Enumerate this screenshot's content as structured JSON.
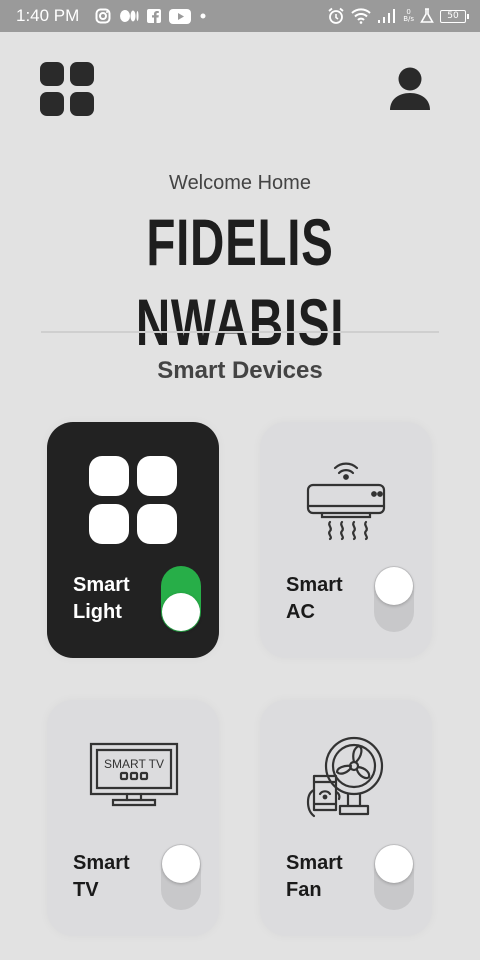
{
  "status_bar": {
    "time": "1:40 PM",
    "net_speed_value": "0",
    "net_speed_unit": "B/s",
    "battery": "50"
  },
  "header": {
    "welcome": "Welcome Home",
    "username": "FIDELIS NWABISI"
  },
  "section_title": "Smart Devices",
  "devices": [
    {
      "label": "Smart\nLight",
      "on": true,
      "icon": "light-grid-icon"
    },
    {
      "label": "Smart\nAC",
      "on": false,
      "icon": "air-conditioner-icon"
    },
    {
      "label": "Smart\nTV",
      "on": false,
      "icon": "smart-tv-icon",
      "icon_text": "SMART TV"
    },
    {
      "label": "Smart\nFan",
      "on": false,
      "icon": "fan-phone-icon"
    }
  ],
  "colors": {
    "background": "#e2e2e2",
    "card": "#dcdcde",
    "card_active": "#222222",
    "toggle_on": "#27ae48",
    "toggle_off": "#c8c8ca"
  }
}
